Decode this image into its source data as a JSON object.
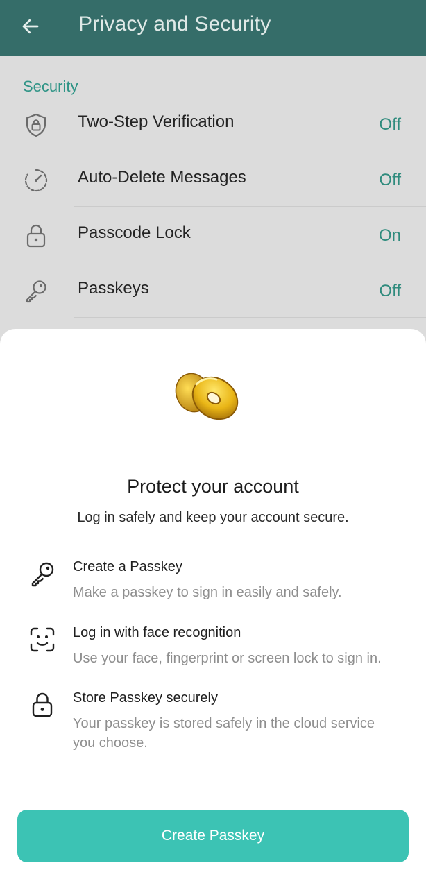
{
  "header": {
    "title": "Privacy and Security",
    "back_icon": "arrow-left-icon",
    "background": "#356d69"
  },
  "security": {
    "section_title": "Security",
    "rows": [
      {
        "label": "Two-Step Verification",
        "value": "Off",
        "icon": "shield-lock-icon"
      },
      {
        "label": "Auto-Delete Messages",
        "value": "Off",
        "icon": "timer-icon"
      },
      {
        "label": "Passcode Lock",
        "value": "On",
        "icon": "lock-icon"
      },
      {
        "label": "Passkeys",
        "value": "Off",
        "icon": "key-icon"
      }
    ]
  },
  "sheet": {
    "sticker_icon": "golden-key-sticker-icon",
    "title": "Protect your account",
    "subtitle": "Log in safely and keep your account secure.",
    "features": [
      {
        "title": "Create a Passkey",
        "description": "Make a passkey to sign in easily and safely.",
        "icon": "key-icon"
      },
      {
        "title": "Log in with face recognition",
        "description": "Use your face, fingerprint or screen lock to sign in.",
        "icon": "face-scan-icon"
      },
      {
        "title": "Store Passkey securely",
        "description": "Your passkey is stored safely in the cloud service you choose.",
        "icon": "lock-icon"
      }
    ],
    "cta_label": "Create Passkey",
    "accent": "#3cc3b4"
  }
}
